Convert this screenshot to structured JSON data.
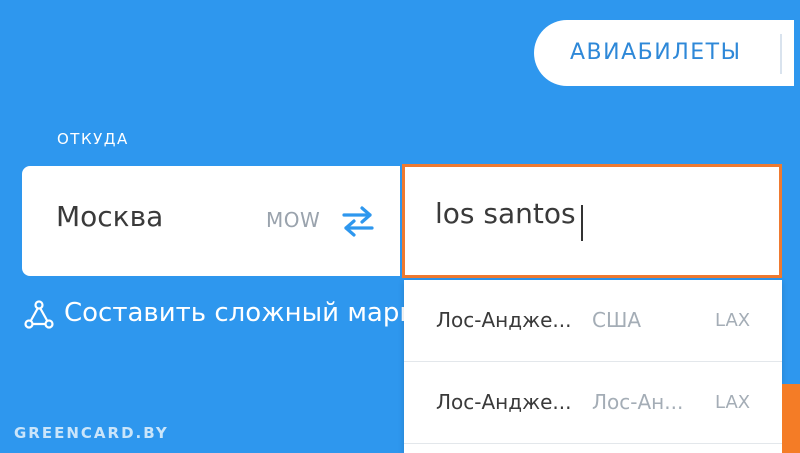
{
  "tabs": {
    "active_label": "АВИАБИЛЕТЫ"
  },
  "search": {
    "from_label": "ОТКУДА",
    "from_city": "Москва",
    "from_code": "MOW",
    "to_value": "los santos",
    "complex_route_label": "Составить сложный марш"
  },
  "suggestions": [
    {
      "city": "Лос-Андже...",
      "country": "США",
      "code": "LAX"
    },
    {
      "city": "Лос-Андже...",
      "country": "Лос-Ан...",
      "code": "LAX"
    }
  ],
  "watermark": "GREENCARD.BY",
  "colors": {
    "background": "#2e97ee",
    "accent_orange": "#ef7a30",
    "tab_text": "#2e88d8"
  }
}
